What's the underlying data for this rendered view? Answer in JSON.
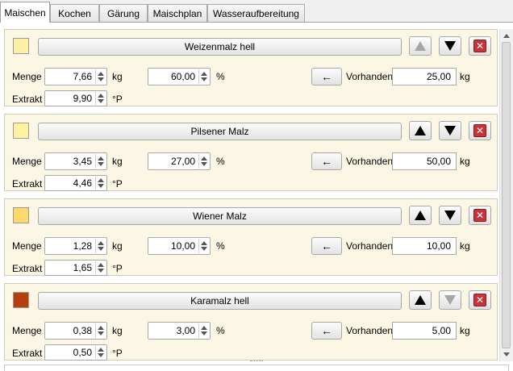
{
  "tabs": [
    {
      "label": "Maischen",
      "active": true
    },
    {
      "label": "Kochen",
      "active": false
    },
    {
      "label": "Gärung",
      "active": false
    },
    {
      "label": "Maischplan",
      "active": false
    },
    {
      "label": "Wasseraufbereitung",
      "active": false
    }
  ],
  "labels": {
    "menge": "Menge",
    "extrakt": "Extrakt",
    "kg": "kg",
    "percent": "%",
    "plato": "°P",
    "vorhanden": "Vorhanden",
    "take_arrow": "←",
    "delete": "✕"
  },
  "malts": [
    {
      "name": "Weizenmalz hell",
      "color": "#fdf0a6",
      "menge": "7,66",
      "prozent": "60,00",
      "extrakt": "9,90",
      "vorhanden": "25,00",
      "up_enabled": false,
      "down_enabled": true
    },
    {
      "name": "Pilsener Malz",
      "color": "#fff19e",
      "menge": "3,45",
      "prozent": "27,00",
      "extrakt": "4,46",
      "vorhanden": "50,00",
      "up_enabled": true,
      "down_enabled": true
    },
    {
      "name": "Wiener Malz",
      "color": "#fcd96b",
      "menge": "1,28",
      "prozent": "10,00",
      "extrakt": "1,65",
      "vorhanden": "10,00",
      "up_enabled": true,
      "down_enabled": true
    },
    {
      "name": "Karamalz hell",
      "color": "#b83f0c",
      "menge": "0,38",
      "prozent": "3,00",
      "extrakt": "0,50",
      "vorhanden": "5,00",
      "up_enabled": true,
      "down_enabled": false
    }
  ]
}
